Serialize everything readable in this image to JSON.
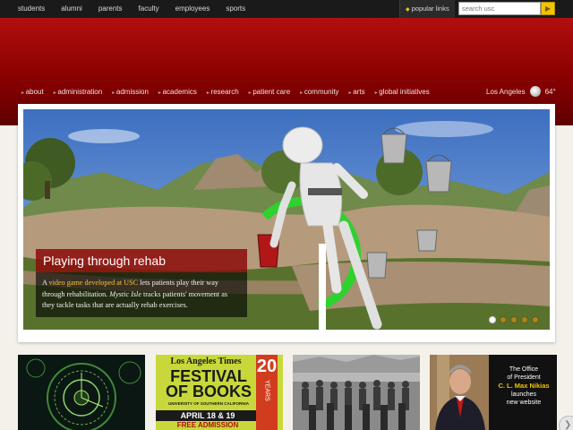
{
  "top_nav": {
    "links": [
      "students",
      "alumni",
      "parents",
      "faculty",
      "employees",
      "sports"
    ],
    "popular_links": "popular links",
    "search_placeholder": "search usc"
  },
  "main_nav": {
    "items": [
      "about",
      "administration",
      "admission",
      "academics",
      "research",
      "patient care",
      "community",
      "arts",
      "global initiatives"
    ],
    "weather": {
      "city": "Los Angeles",
      "temp": "64°",
      "icon": "cloud-icon"
    }
  },
  "hero": {
    "title": "Playing through rehab",
    "caption_pre": "A ",
    "caption_link": "video game developed at USC",
    "caption_mid": " lets patients play their way through rehabilitation. ",
    "caption_em": "Mystic Isle",
    "caption_post": " tracks patients' movement as they tackle tasks that are actually rehab exercises.",
    "slides": 5,
    "active_slide": 1
  },
  "thumbs": {
    "festival": {
      "masthead": "Los Angeles Times",
      "line1": "FESTIVAL",
      "line2": "OF BOOKS",
      "university": "UNIVERSITY OF SOUTHERN CALIFORNIA",
      "dates": "APRIL 18 & 19",
      "admission": "FREE ADMISSION",
      "years_number": "20",
      "years_label": "YEARS"
    },
    "president": {
      "line1": "The Office",
      "line2": "of President",
      "name": "C. L. Max Nikias",
      "line3": "launches",
      "line4": "new website"
    }
  },
  "colors": {
    "cardinal": "#990000",
    "gold": "#f2c400"
  }
}
